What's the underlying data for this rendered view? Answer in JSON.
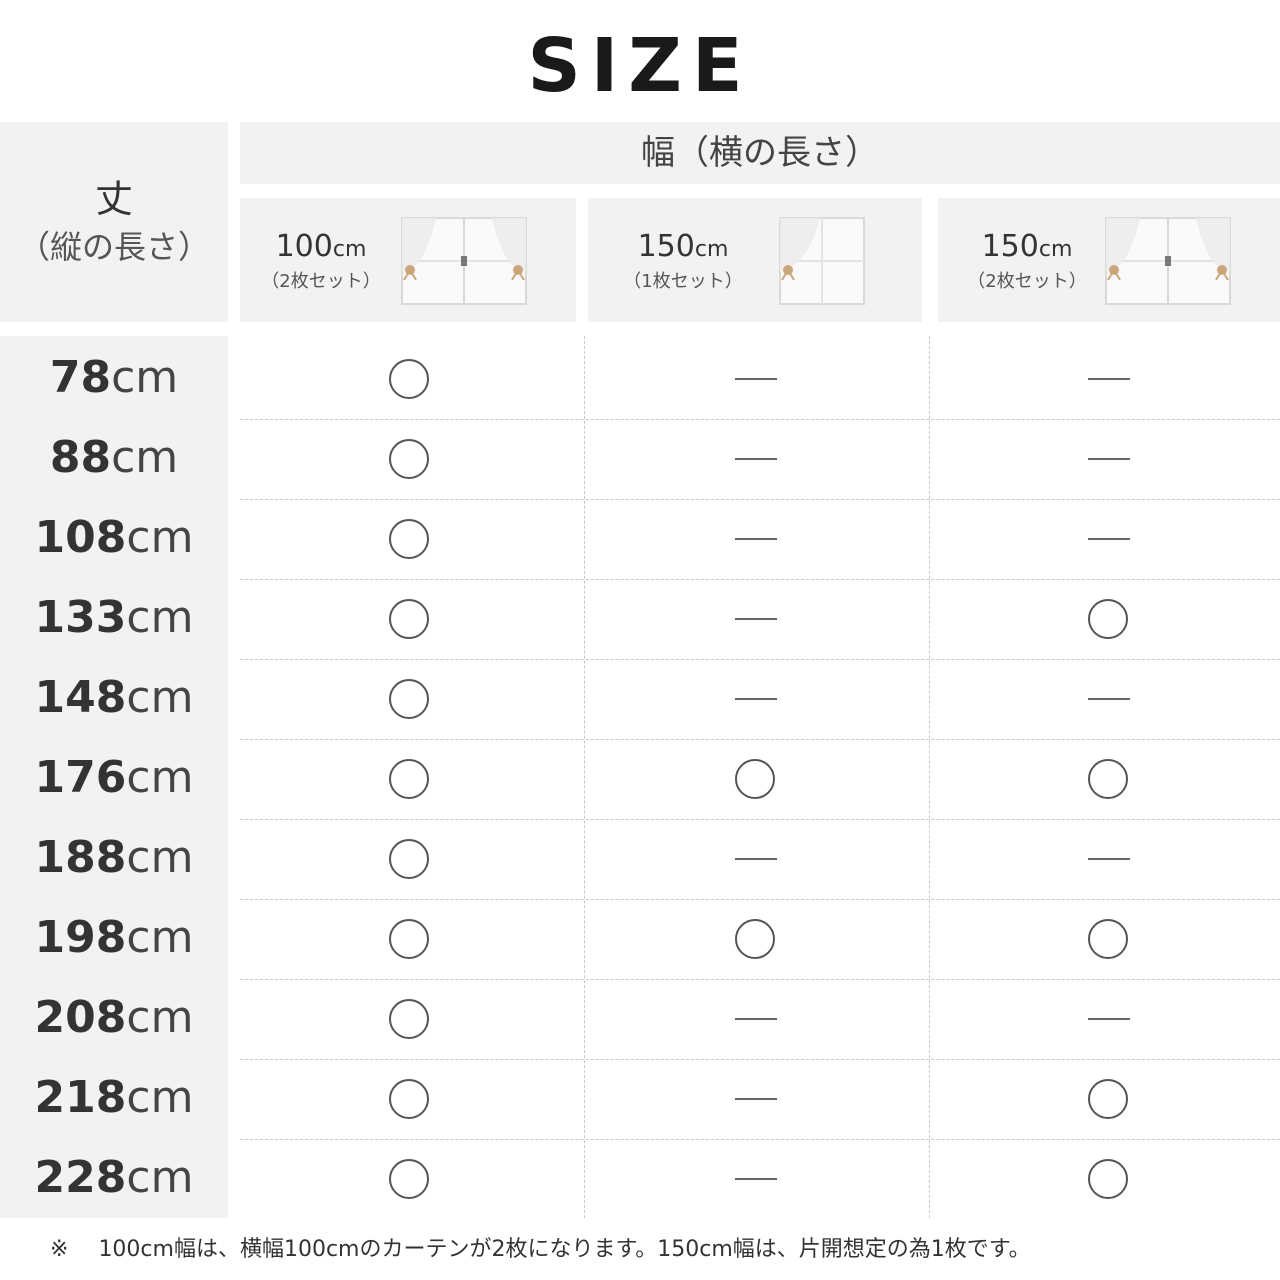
{
  "title": "SIZE",
  "header": {
    "length_label": "丈",
    "length_sub": "（縦の長さ）",
    "width_label": "幅（横の長さ）"
  },
  "columns": [
    {
      "size_num": "100",
      "size_unit": "cm",
      "set": "（2枚セット）",
      "panels": "double"
    },
    {
      "size_num": "150",
      "size_unit": "cm",
      "set": "（1枚セット）",
      "panels": "single"
    },
    {
      "size_num": "150",
      "size_unit": "cm",
      "set": "（2枚セット）",
      "panels": "double"
    }
  ],
  "rows": [
    {
      "num": "78",
      "unit": "cm",
      "avail": [
        "○",
        "—",
        "—"
      ]
    },
    {
      "num": "88",
      "unit": "cm",
      "avail": [
        "○",
        "—",
        "—"
      ]
    },
    {
      "num": "108",
      "unit": "cm",
      "avail": [
        "○",
        "—",
        "—"
      ]
    },
    {
      "num": "133",
      "unit": "cm",
      "avail": [
        "○",
        "—",
        "○"
      ]
    },
    {
      "num": "148",
      "unit": "cm",
      "avail": [
        "○",
        "—",
        "—"
      ]
    },
    {
      "num": "176",
      "unit": "cm",
      "avail": [
        "○",
        "○",
        "○"
      ]
    },
    {
      "num": "188",
      "unit": "cm",
      "avail": [
        "○",
        "—",
        "—"
      ]
    },
    {
      "num": "198",
      "unit": "cm",
      "avail": [
        "○",
        "○",
        "○"
      ]
    },
    {
      "num": "208",
      "unit": "cm",
      "avail": [
        "○",
        "—",
        "—"
      ]
    },
    {
      "num": "218",
      "unit": "cm",
      "avail": [
        "○",
        "—",
        "○"
      ]
    },
    {
      "num": "228",
      "unit": "cm",
      "avail": [
        "○",
        "—",
        "○"
      ]
    }
  ],
  "footnote": {
    "mark": "※",
    "text": "100cm幅は、横幅100cmのカーテンが2枚になります。150cm幅は、片開想定の為1枚です。"
  },
  "colors": {
    "header_bg": "#f2f2f2",
    "text": "#333333",
    "bow": "#c9a77a"
  }
}
